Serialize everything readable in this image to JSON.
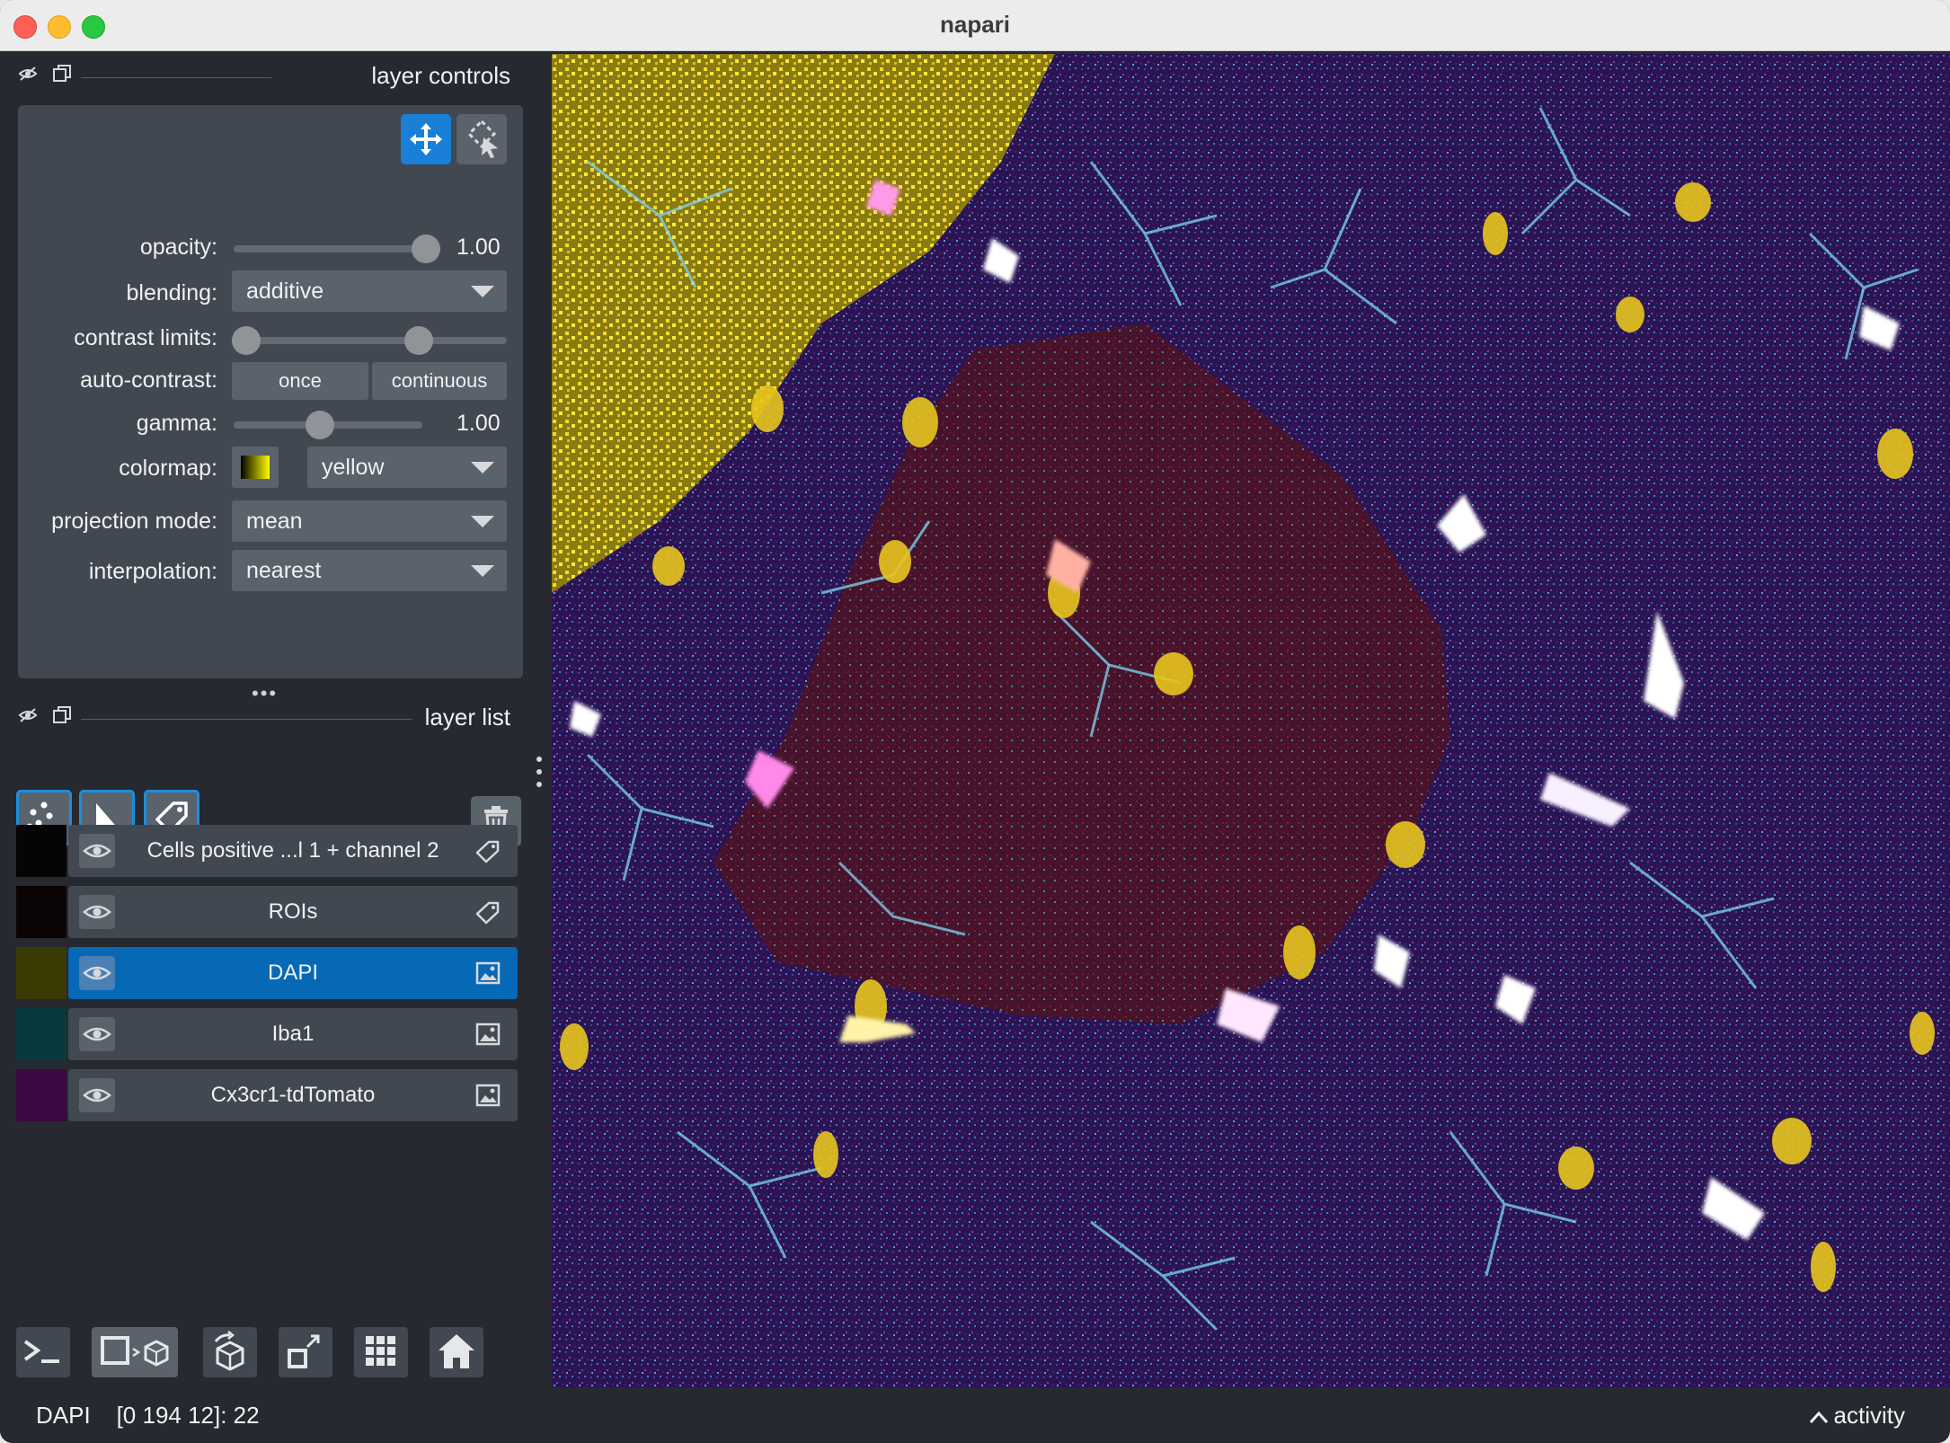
{
  "window": {
    "title": "napari"
  },
  "layer_controls": {
    "header": "layer controls",
    "opacity_label": "opacity:",
    "opacity_value": "1.00",
    "opacity_fraction": 1.0,
    "blending_label": "blending:",
    "blending_value": "additive",
    "contrast_label": "contrast limits:",
    "contrast_low_fraction": 0.0,
    "contrast_high_fraction": 0.7,
    "autocontrast_label": "auto-contrast:",
    "autocontrast_once": "once",
    "autocontrast_continuous": "continuous",
    "gamma_label": "gamma:",
    "gamma_value": "1.00",
    "gamma_fraction": 0.45,
    "colormap_label": "colormap:",
    "colormap_value": "yellow",
    "projection_label": "projection mode:",
    "projection_value": "mean",
    "interpolation_label": "interpolation:",
    "interpolation_value": "nearest"
  },
  "layer_list": {
    "header": "layer list",
    "layers": [
      {
        "name": "Cells positive ...l 1 + channel 2",
        "type": "labels",
        "selected": false,
        "thumb_color": "#050505"
      },
      {
        "name": "ROIs",
        "type": "labels",
        "selected": false,
        "thumb_color": "#0b0405"
      },
      {
        "name": "DAPI",
        "type": "image",
        "selected": true,
        "thumb_color": "#3a3a05"
      },
      {
        "name": "Iba1",
        "type": "image",
        "selected": false,
        "thumb_color": "#073a3c"
      },
      {
        "name": "Cx3cr1-tdTomato",
        "type": "image",
        "selected": false,
        "thumb_color": "#3c0744"
      }
    ]
  },
  "status": {
    "left": "DAPI    [0 194 12]: 22",
    "right": "activity"
  },
  "colors": {
    "accent": "#0768b6",
    "button_border": "#1a8fe0",
    "panel": "#414851",
    "background": "#262930"
  }
}
